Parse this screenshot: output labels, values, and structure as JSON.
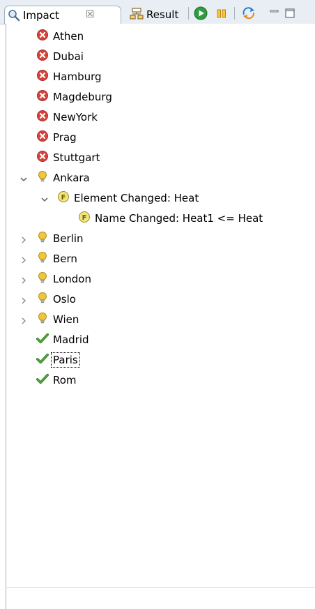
{
  "tabs": {
    "impact": {
      "label": "Impact",
      "close_glyph": "☒",
      "icon": "search-icon"
    },
    "result": {
      "label": "Result",
      "icon": "result-table-icon"
    }
  },
  "toolbar": {
    "buttons": [
      {
        "name": "run-icon",
        "color": "#2e9c3e"
      },
      {
        "name": "pause-icon",
        "color": "#e8b017"
      },
      {
        "name": "sync-icon",
        "color": "#e08a2a"
      },
      {
        "name": "minimize-icon"
      },
      {
        "name": "maximize-icon"
      }
    ]
  },
  "colors": {
    "error": "#d8413a",
    "warning_bulb": "#f0c63a",
    "ok": "#4fa43a",
    "element_badge": "#f2e57c"
  },
  "tree": {
    "items": [
      {
        "label": "Athen",
        "status": "error"
      },
      {
        "label": "Dubai",
        "status": "error"
      },
      {
        "label": "Hamburg",
        "status": "error"
      },
      {
        "label": "Magdeburg",
        "status": "error"
      },
      {
        "label": "NewYork",
        "status": "error"
      },
      {
        "label": "Prag",
        "status": "error"
      },
      {
        "label": "Stuttgart",
        "status": "error"
      },
      {
        "label": "Ankara",
        "status": "warning",
        "expanded": true
      },
      {
        "label": "Element Changed: Heat",
        "status": "element",
        "expanded": true
      },
      {
        "label": "Name Changed: Heat1 <= Heat",
        "status": "element"
      },
      {
        "label": "Berlin",
        "status": "warning",
        "expanded": false
      },
      {
        "label": "Bern",
        "status": "warning",
        "expanded": false
      },
      {
        "label": "London",
        "status": "warning",
        "expanded": false
      },
      {
        "label": "Oslo",
        "status": "warning",
        "expanded": false
      },
      {
        "label": "Wien",
        "status": "warning",
        "expanded": false
      },
      {
        "label": "Madrid",
        "status": "ok"
      },
      {
        "label": "Paris",
        "status": "ok",
        "selected": true
      },
      {
        "label": "Rom",
        "status": "ok"
      }
    ]
  }
}
